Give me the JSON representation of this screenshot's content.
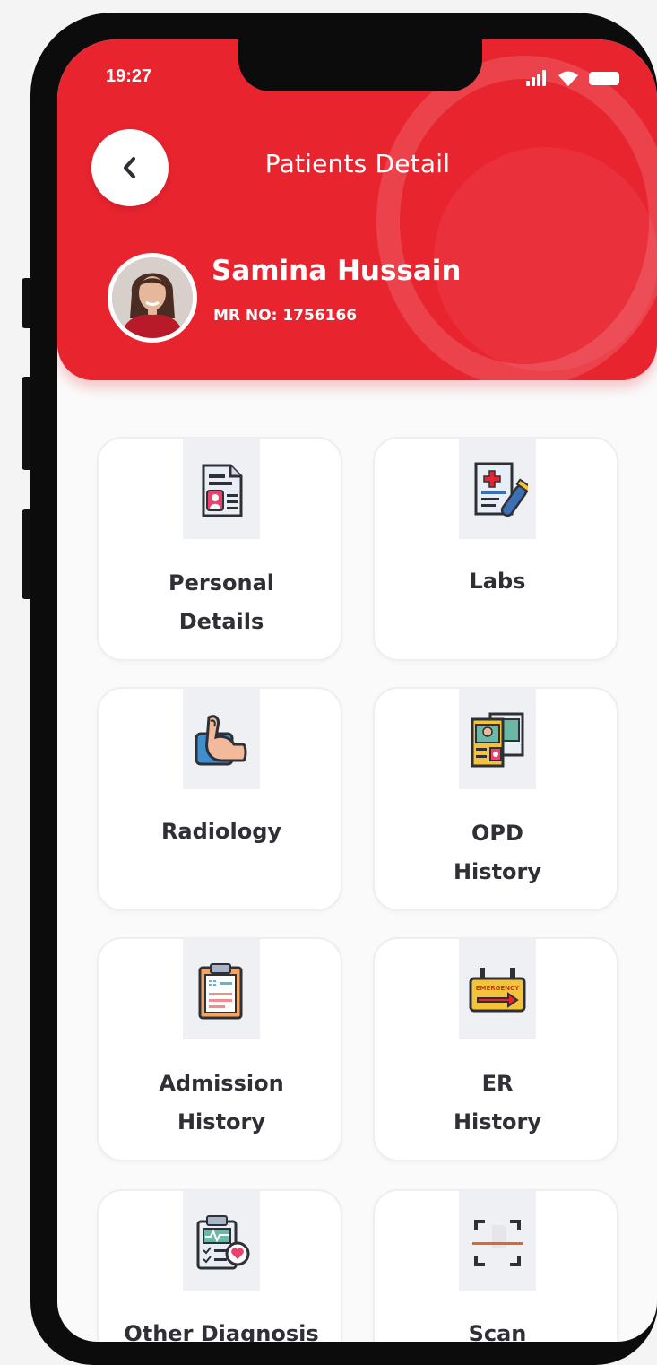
{
  "status_bar": {
    "time": "19:27",
    "icons": [
      "signal-icon",
      "wifi-icon",
      "battery-icon"
    ]
  },
  "header": {
    "title": "Patients Detail",
    "back_icon": "chevron-left-icon",
    "patient_name": "Samina Hussain",
    "mr_no": "MR NO: 1756166"
  },
  "menu": {
    "items": [
      {
        "label": "Personal\nDetails",
        "icon": "personal-details-icon"
      },
      {
        "label": "Labs",
        "icon": "labs-icon"
      },
      {
        "label": "Radiology",
        "icon": "radiology-icon"
      },
      {
        "label": "OPD\nHistory",
        "icon": "opd-history-icon"
      },
      {
        "label": "Admission\nHistory",
        "icon": "admission-history-icon"
      },
      {
        "label": "ER\nHistory",
        "icon": "er-history-icon",
        "sign_text": "EMERGENCY"
      },
      {
        "label": "Other Diagnosis",
        "icon": "other-diagnosis-icon"
      },
      {
        "label": "Scan",
        "icon": "scan-icon"
      }
    ]
  },
  "colors": {
    "primary": "#e8242f",
    "label_text": "#2f2f36",
    "background": "#fafafa"
  }
}
